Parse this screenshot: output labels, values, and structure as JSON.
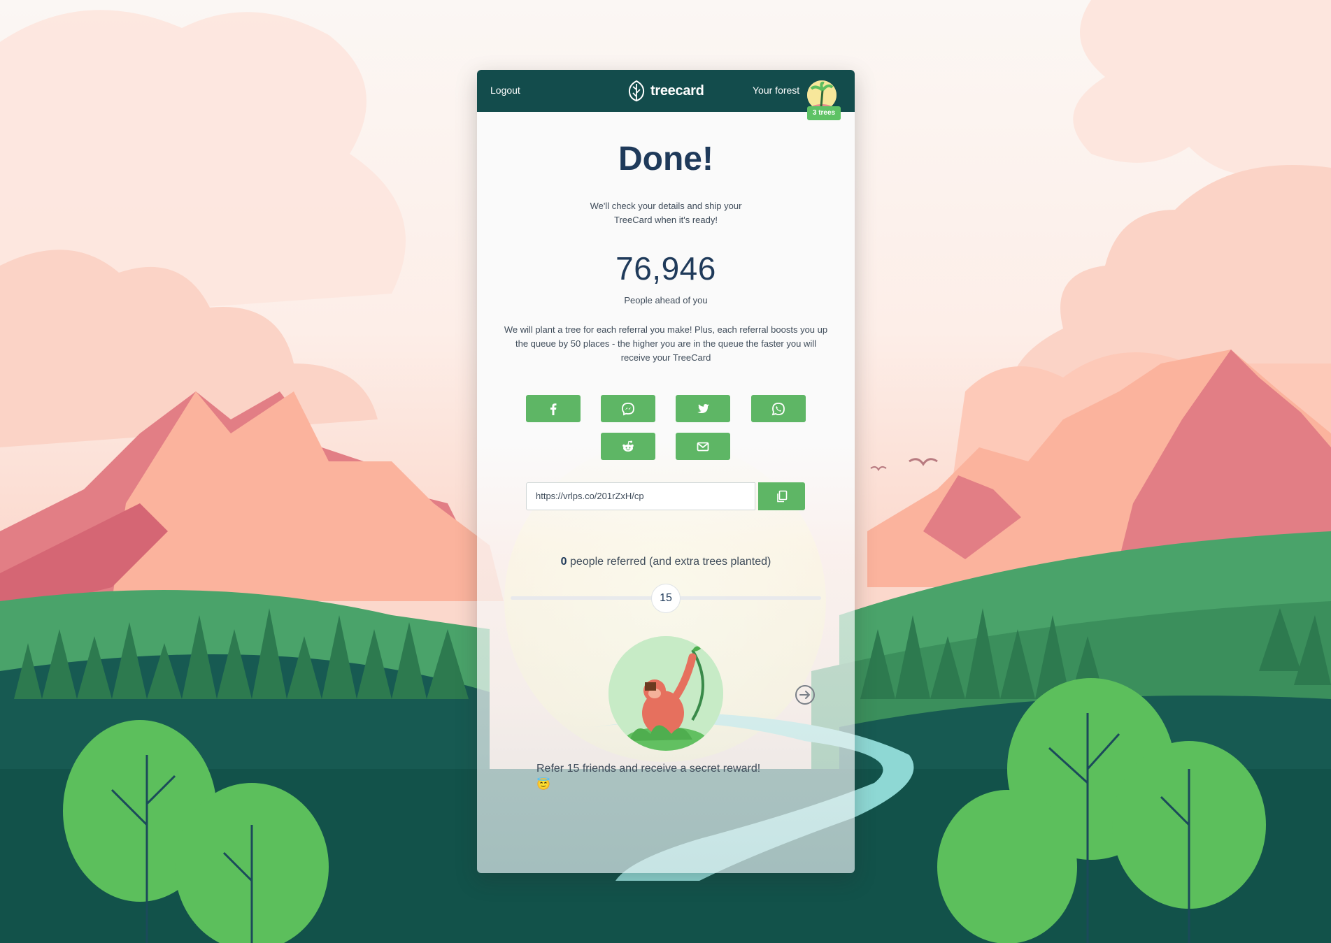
{
  "header": {
    "logout_label": "Logout",
    "logo_text": "treecard",
    "your_forest_label": "Your forest",
    "trees_badge": "3 trees"
  },
  "main": {
    "title": "Done!",
    "subtitle_line1": "We'll check your details and ship your",
    "subtitle_line2": "TreeCard when it's ready!",
    "counter": "76,946",
    "counter_label": "People ahead of you",
    "description": "We will plant a tree for each referral you make! Plus, each referral boosts you up the queue by 50 places - the higher you are in the queue the faster you will receive your TreeCard"
  },
  "share": {
    "buttons": [
      {
        "icon": "facebook-icon"
      },
      {
        "icon": "messenger-icon"
      },
      {
        "icon": "twitter-icon"
      },
      {
        "icon": "whatsapp-icon"
      },
      {
        "icon": "reddit-icon"
      },
      {
        "icon": "email-icon"
      }
    ],
    "referral_url": "https://vrlps.co/201rZxH/cp",
    "copy_icon": "copy-icon"
  },
  "referrals": {
    "count": "0",
    "label": "people referred (and extra trees planted)",
    "milestone": "15",
    "progress": 0
  },
  "reward": {
    "text": "Refer 15 friends and receive a secret reward!",
    "emoji": "😇",
    "next_icon": "arrow-right-circle-icon"
  },
  "colors": {
    "header_bg": "#134c4c",
    "accent_green": "#5eb665",
    "text_navy": "#1f3a5a"
  }
}
